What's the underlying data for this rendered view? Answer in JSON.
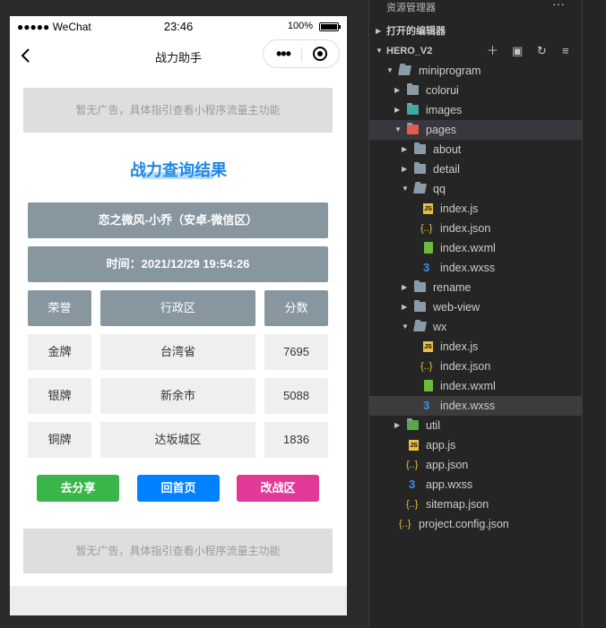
{
  "phone": {
    "status_bar": {
      "carrier": "●●●●● WeChat",
      "time": "23:46",
      "battery": "100%"
    },
    "nav": {
      "title": "战力助手"
    },
    "ad_text": "暂无广告，具体指引查看小程序流量主功能",
    "result_title": "战力查询结果",
    "hero_info": "恋之微风-小乔（安卓-微信区）",
    "time_info": "时间：2021/12/29 19:54:26",
    "table": {
      "headers": [
        "荣誉",
        "行政区",
        "分数"
      ],
      "rows": [
        [
          "金牌",
          "台湾省",
          "7695"
        ],
        [
          "银牌",
          "新余市",
          "5088"
        ],
        [
          "铜牌",
          "达坂城区",
          "1836"
        ]
      ]
    },
    "buttons": {
      "share": "去分享",
      "home": "回首页",
      "change_region": "改战区"
    },
    "colors": {
      "share": "#39b54a",
      "home": "#0081ff",
      "change_region": "#e03997",
      "title": "#1e88e5",
      "bar": "#87969f"
    }
  },
  "explorer": {
    "title": "资源管理器",
    "more": "···",
    "open_editors": "打开的编辑器",
    "project": "HERO_V2",
    "tree": [
      {
        "label": "miniprogram",
        "icon": "folder-open-icon"
      },
      {
        "label": "colorui",
        "icon": "folder-icon"
      },
      {
        "label": "images",
        "icon": "images-folder-icon"
      },
      {
        "label": "pages",
        "icon": "pages-folder-icon"
      },
      {
        "label": "about",
        "icon": "folder-icon"
      },
      {
        "label": "detail",
        "icon": "folder-icon"
      },
      {
        "label": "qq",
        "icon": "folder-open-icon"
      },
      {
        "label": "index.js",
        "icon": "js-icon"
      },
      {
        "label": "index.json",
        "icon": "json-icon"
      },
      {
        "label": "index.wxml",
        "icon": "wxml-icon"
      },
      {
        "label": "index.wxss",
        "icon": "wxss-icon"
      },
      {
        "label": "rename",
        "icon": "folder-icon"
      },
      {
        "label": "web-view",
        "icon": "folder-icon"
      },
      {
        "label": "wx",
        "icon": "folder-open-icon"
      },
      {
        "label": "index.js",
        "icon": "js-icon"
      },
      {
        "label": "index.json",
        "icon": "json-icon"
      },
      {
        "label": "index.wxml",
        "icon": "wxml-icon"
      },
      {
        "label": "index.wxss",
        "icon": "wxss-icon"
      },
      {
        "label": "util",
        "icon": "util-folder-icon"
      },
      {
        "label": "app.js",
        "icon": "js-icon"
      },
      {
        "label": "app.json",
        "icon": "json-icon"
      },
      {
        "label": "app.wxss",
        "icon": "wxss-icon"
      },
      {
        "label": "sitemap.json",
        "icon": "json-icon"
      },
      {
        "label": "project.config.json",
        "icon": "json-icon"
      }
    ]
  }
}
